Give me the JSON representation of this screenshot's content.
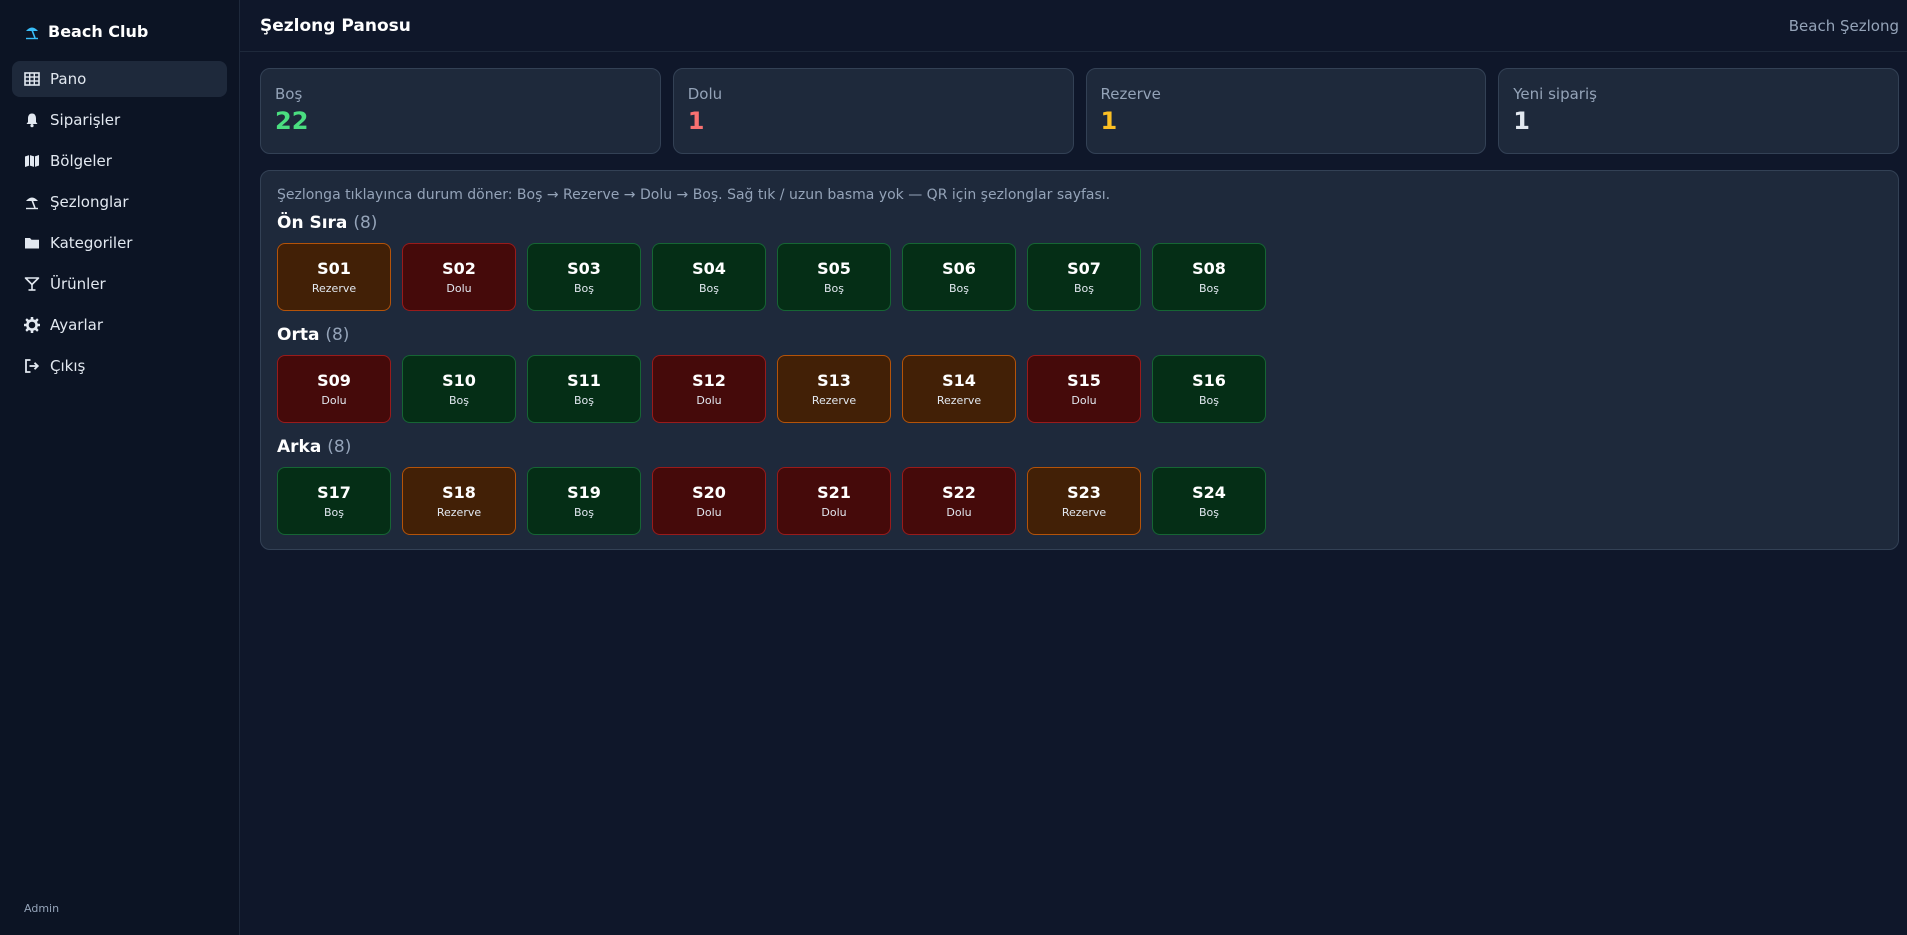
{
  "brand": {
    "name": "Beach Club",
    "icon": "umbrella-beach-icon"
  },
  "sidebar": {
    "items": [
      {
        "label": "Pano",
        "icon": "grid-icon",
        "active": true
      },
      {
        "label": "Siparişler",
        "icon": "bell-icon",
        "active": false
      },
      {
        "label": "Bölgeler",
        "icon": "map-icon",
        "active": false
      },
      {
        "label": "Şezlonglar",
        "icon": "umbrella-beach-icon",
        "active": false
      },
      {
        "label": "Kategoriler",
        "icon": "folder-icon",
        "active": false
      },
      {
        "label": "Ürünler",
        "icon": "cocktail-icon",
        "active": false
      },
      {
        "label": "Ayarlar",
        "icon": "gear-icon",
        "active": false
      },
      {
        "label": "Çıkış",
        "icon": "logout-icon",
        "active": false
      }
    ],
    "footer": "Admin"
  },
  "header": {
    "title": "Şezlong Panosu",
    "right_text": "Beach Şezlong"
  },
  "stats": [
    {
      "label": "Boş",
      "value": "22",
      "color": "#4ade80"
    },
    {
      "label": "Dolu",
      "value": "1",
      "color": "#f87171"
    },
    {
      "label": "Rezerve",
      "value": "1",
      "color": "#fbbf24"
    },
    {
      "label": "Yeni sipariş",
      "value": "1",
      "color": "#e2e8f0"
    }
  ],
  "hint": "Şezlonga tıklayınca durum döner: Boş → Rezerve → Dolu → Boş. Sağ tık / uzun basma yok — QR için şezlonglar sayfası.",
  "status_colors": {
    "Boş": "#052e16",
    "Dolu": "#450a0a",
    "Rezerve": "#422006"
  },
  "zones": [
    {
      "name": "Ön Sıra",
      "count": "(8)",
      "loungers": [
        {
          "code": "S01",
          "status": "Rezerve"
        },
        {
          "code": "S02",
          "status": "Dolu"
        },
        {
          "code": "S03",
          "status": "Boş"
        },
        {
          "code": "S04",
          "status": "Boş"
        },
        {
          "code": "S05",
          "status": "Boş"
        },
        {
          "code": "S06",
          "status": "Boş"
        },
        {
          "code": "S07",
          "status": "Boş"
        },
        {
          "code": "S08",
          "status": "Boş"
        }
      ]
    },
    {
      "name": "Orta",
      "count": "(8)",
      "loungers": [
        {
          "code": "S09",
          "status": "Dolu"
        },
        {
          "code": "S10",
          "status": "Boş"
        },
        {
          "code": "S11",
          "status": "Boş"
        },
        {
          "code": "S12",
          "status": "Dolu"
        },
        {
          "code": "S13",
          "status": "Rezerve"
        },
        {
          "code": "S14",
          "status": "Rezerve"
        },
        {
          "code": "S15",
          "status": "Dolu"
        },
        {
          "code": "S16",
          "status": "Boş"
        }
      ]
    },
    {
      "name": "Arka",
      "count": "(8)",
      "loungers": [
        {
          "code": "S17",
          "status": "Boş"
        },
        {
          "code": "S18",
          "status": "Rezerve"
        },
        {
          "code": "S19",
          "status": "Boş"
        },
        {
          "code": "S20",
          "status": "Dolu"
        },
        {
          "code": "S21",
          "status": "Dolu"
        },
        {
          "code": "S22",
          "status": "Dolu"
        },
        {
          "code": "S23",
          "status": "Rezerve"
        },
        {
          "code": "S24",
          "status": "Boş"
        }
      ]
    }
  ]
}
